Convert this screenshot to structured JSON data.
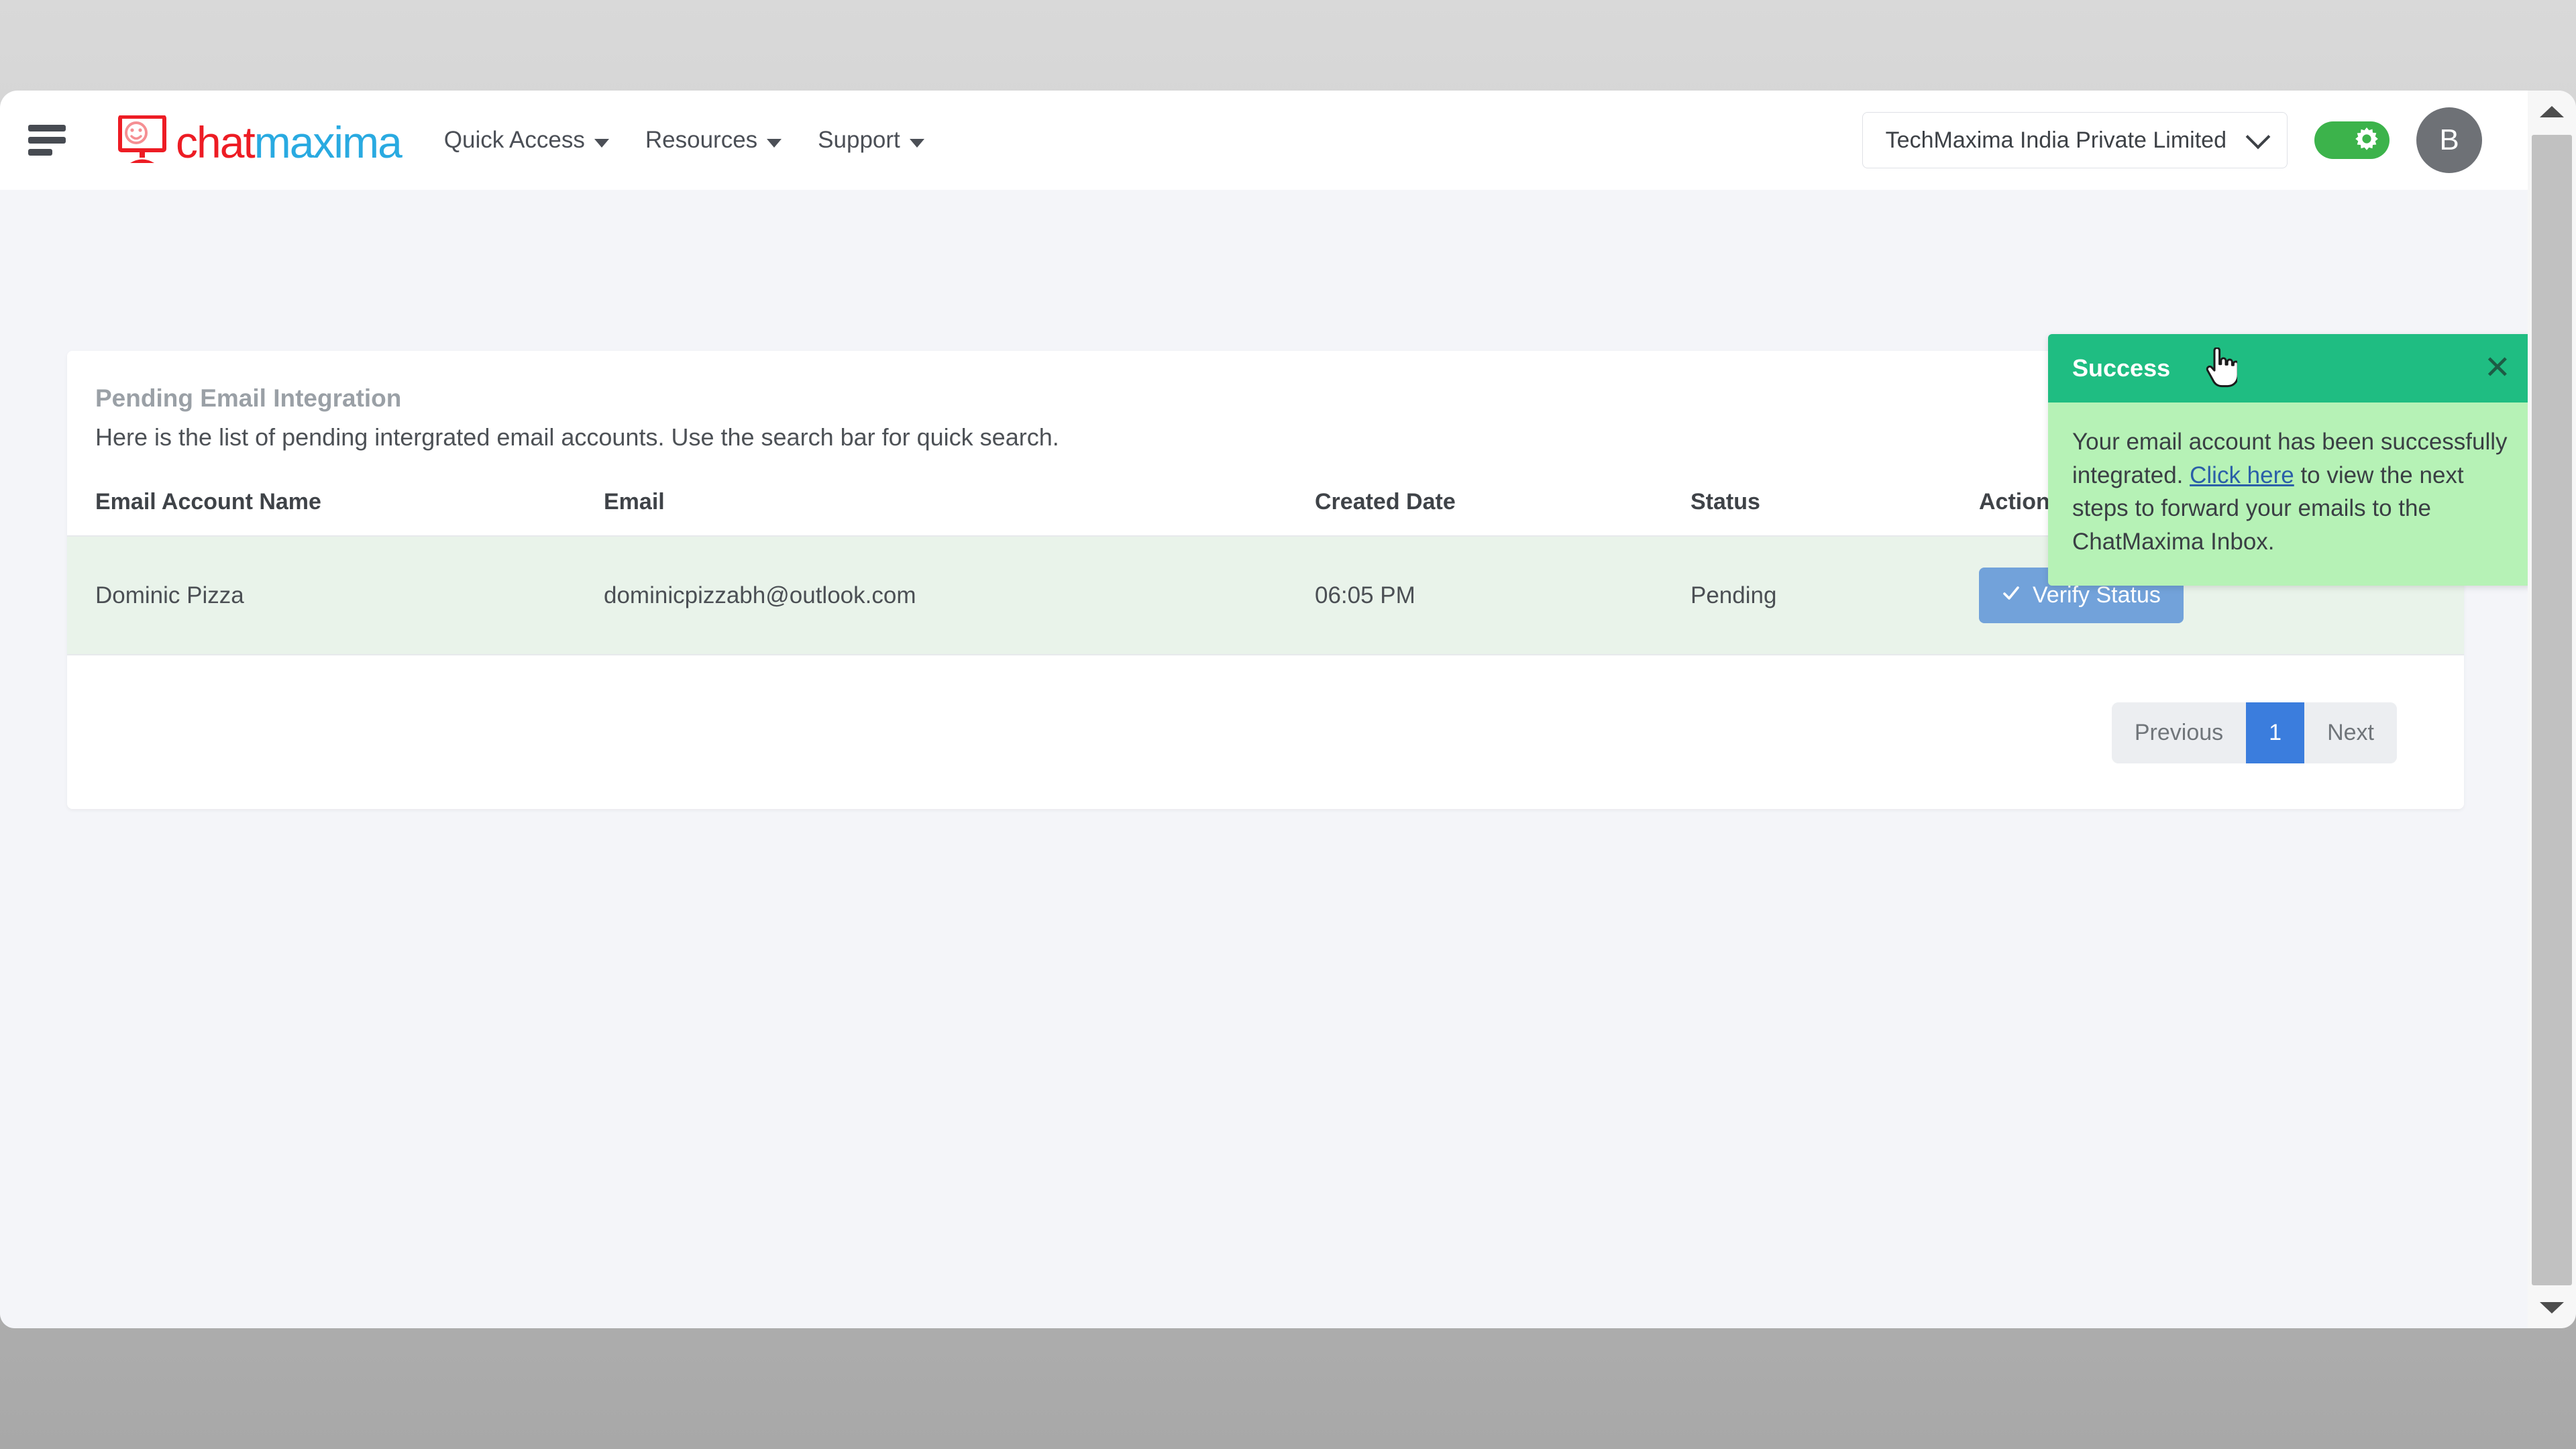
{
  "topbar": {
    "menu_icon": "hamburger-icon",
    "logo": {
      "part1": "chat",
      "part2": "maxima",
      "icon": "monitor-smiley-icon"
    },
    "nav": [
      {
        "label": "Quick Access",
        "icon": "chevron-down-icon"
      },
      {
        "label": "Resources",
        "icon": "chevron-down-icon"
      },
      {
        "label": "Support",
        "icon": "chevron-down-icon"
      }
    ],
    "company": {
      "value": "TechMaxima India Private Limited",
      "icon": "chevron-down-icon"
    },
    "theme_toggle": {
      "icon": "gear-icon",
      "state": "on",
      "color": "#3cb34b"
    },
    "avatar": {
      "initial": "B",
      "color": "#6e7176"
    }
  },
  "card": {
    "title": "Pending Email Integration",
    "subtitle": "Here is the list of pending intergrated email accounts. Use the search bar for quick search.",
    "columns": [
      "Email Account Name",
      "Email",
      "Created Date",
      "Status",
      "Action"
    ],
    "rows": [
      {
        "name": "Dominic Pizza",
        "email": "dominicpizzabh@outlook.com",
        "created_date": "06:05 PM",
        "status": "Pending",
        "action_label": "Verify Status",
        "action_icon": "check-icon",
        "row_color": "#e9f3ea"
      }
    ]
  },
  "pagination": {
    "previous": "Previous",
    "current": "1",
    "next": "Next",
    "active_color": "#3b7ddd"
  },
  "toast": {
    "title": "Success",
    "close_icon": "close-icon",
    "text_before": "Your email account has been successfully integrated. ",
    "link": "Click here",
    "text_after": " to view the next steps to forward your emails to the ChatMaxima Inbox.",
    "header_color": "#1fbd82",
    "body_color": "#b6f2b6"
  },
  "chat_launcher": {
    "icon": "chat-bubbles-icon",
    "color": "#0d86f5"
  },
  "scrollbar": {
    "up_icon": "scroll-up-arrow-icon",
    "down_icon": "scroll-down-arrow-icon"
  },
  "cursor": {
    "icon": "pointing-hand-cursor"
  }
}
